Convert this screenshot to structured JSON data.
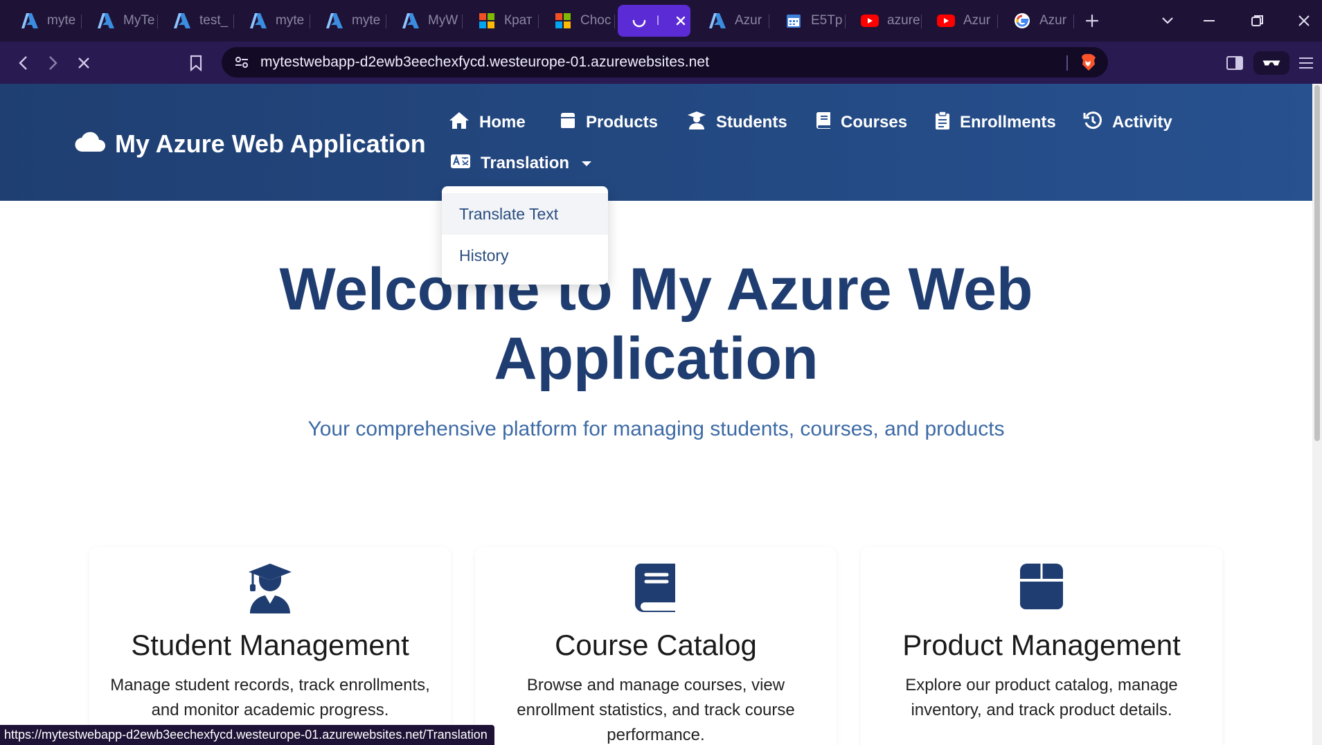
{
  "browser": {
    "tabs": [
      {
        "title": "myte",
        "icon": "azure-icon"
      },
      {
        "title": "MyTe",
        "icon": "azure-icon"
      },
      {
        "title": "test_",
        "icon": "azure-icon"
      },
      {
        "title": "myte",
        "icon": "azure-icon"
      },
      {
        "title": "myte",
        "icon": "azure-icon"
      },
      {
        "title": "MyW",
        "icon": "azure-icon"
      },
      {
        "title": "Крат",
        "icon": "microsoft-icon"
      },
      {
        "title": "Choc",
        "icon": "microsoft-icon"
      },
      {
        "title": "l",
        "icon": "loading-icon",
        "active": true
      },
      {
        "title": "Azur",
        "icon": "azure-icon"
      },
      {
        "title": "E5Tp",
        "icon": "calendar-icon"
      },
      {
        "title": "azure",
        "icon": "youtube-icon"
      },
      {
        "title": "Azur",
        "icon": "youtube-icon"
      },
      {
        "title": "Azur",
        "icon": "google-icon"
      }
    ],
    "url": "mytestwebapp-d2ewb3eechexfycd.westeurope-01.azurewebsites.net",
    "status_url": "https://mytestwebapp-d2ewb3eechexfycd.westeurope-01.azurewebsites.net/Translation",
    "colors": {
      "tabbar": "#1e1336",
      "active_tab": "#5b2bd6",
      "addressbar": "#2a1a52"
    }
  },
  "site": {
    "brand": "My Azure Web Application",
    "nav": {
      "home": "Home",
      "products": "Products",
      "students": "Students",
      "courses": "Courses",
      "enrollments": "Enrollments",
      "activity": "Activity",
      "translation": "Translation"
    },
    "dropdown": {
      "translate_text": "Translate Text",
      "history": "History"
    },
    "hero": {
      "title_line1": "Welcome to My Azure Web",
      "title_line2": "Application",
      "subtitle": "Your comprehensive platform for managing students, courses, and products"
    },
    "cards": [
      {
        "icon": "graduate-icon",
        "title": "Student Management",
        "desc": "Manage student records, track enrollments, and monitor academic progress."
      },
      {
        "icon": "book-icon",
        "title": "Course Catalog",
        "desc": "Browse and manage courses, view enrollment statistics, and track course performance."
      },
      {
        "icon": "box-icon",
        "title": "Product Management",
        "desc": "Explore our product catalog, manage inventory, and track product details."
      }
    ],
    "colors": {
      "header": "#27518f",
      "primary_text": "#1f3d70",
      "accent": "#3d6aa5"
    }
  }
}
